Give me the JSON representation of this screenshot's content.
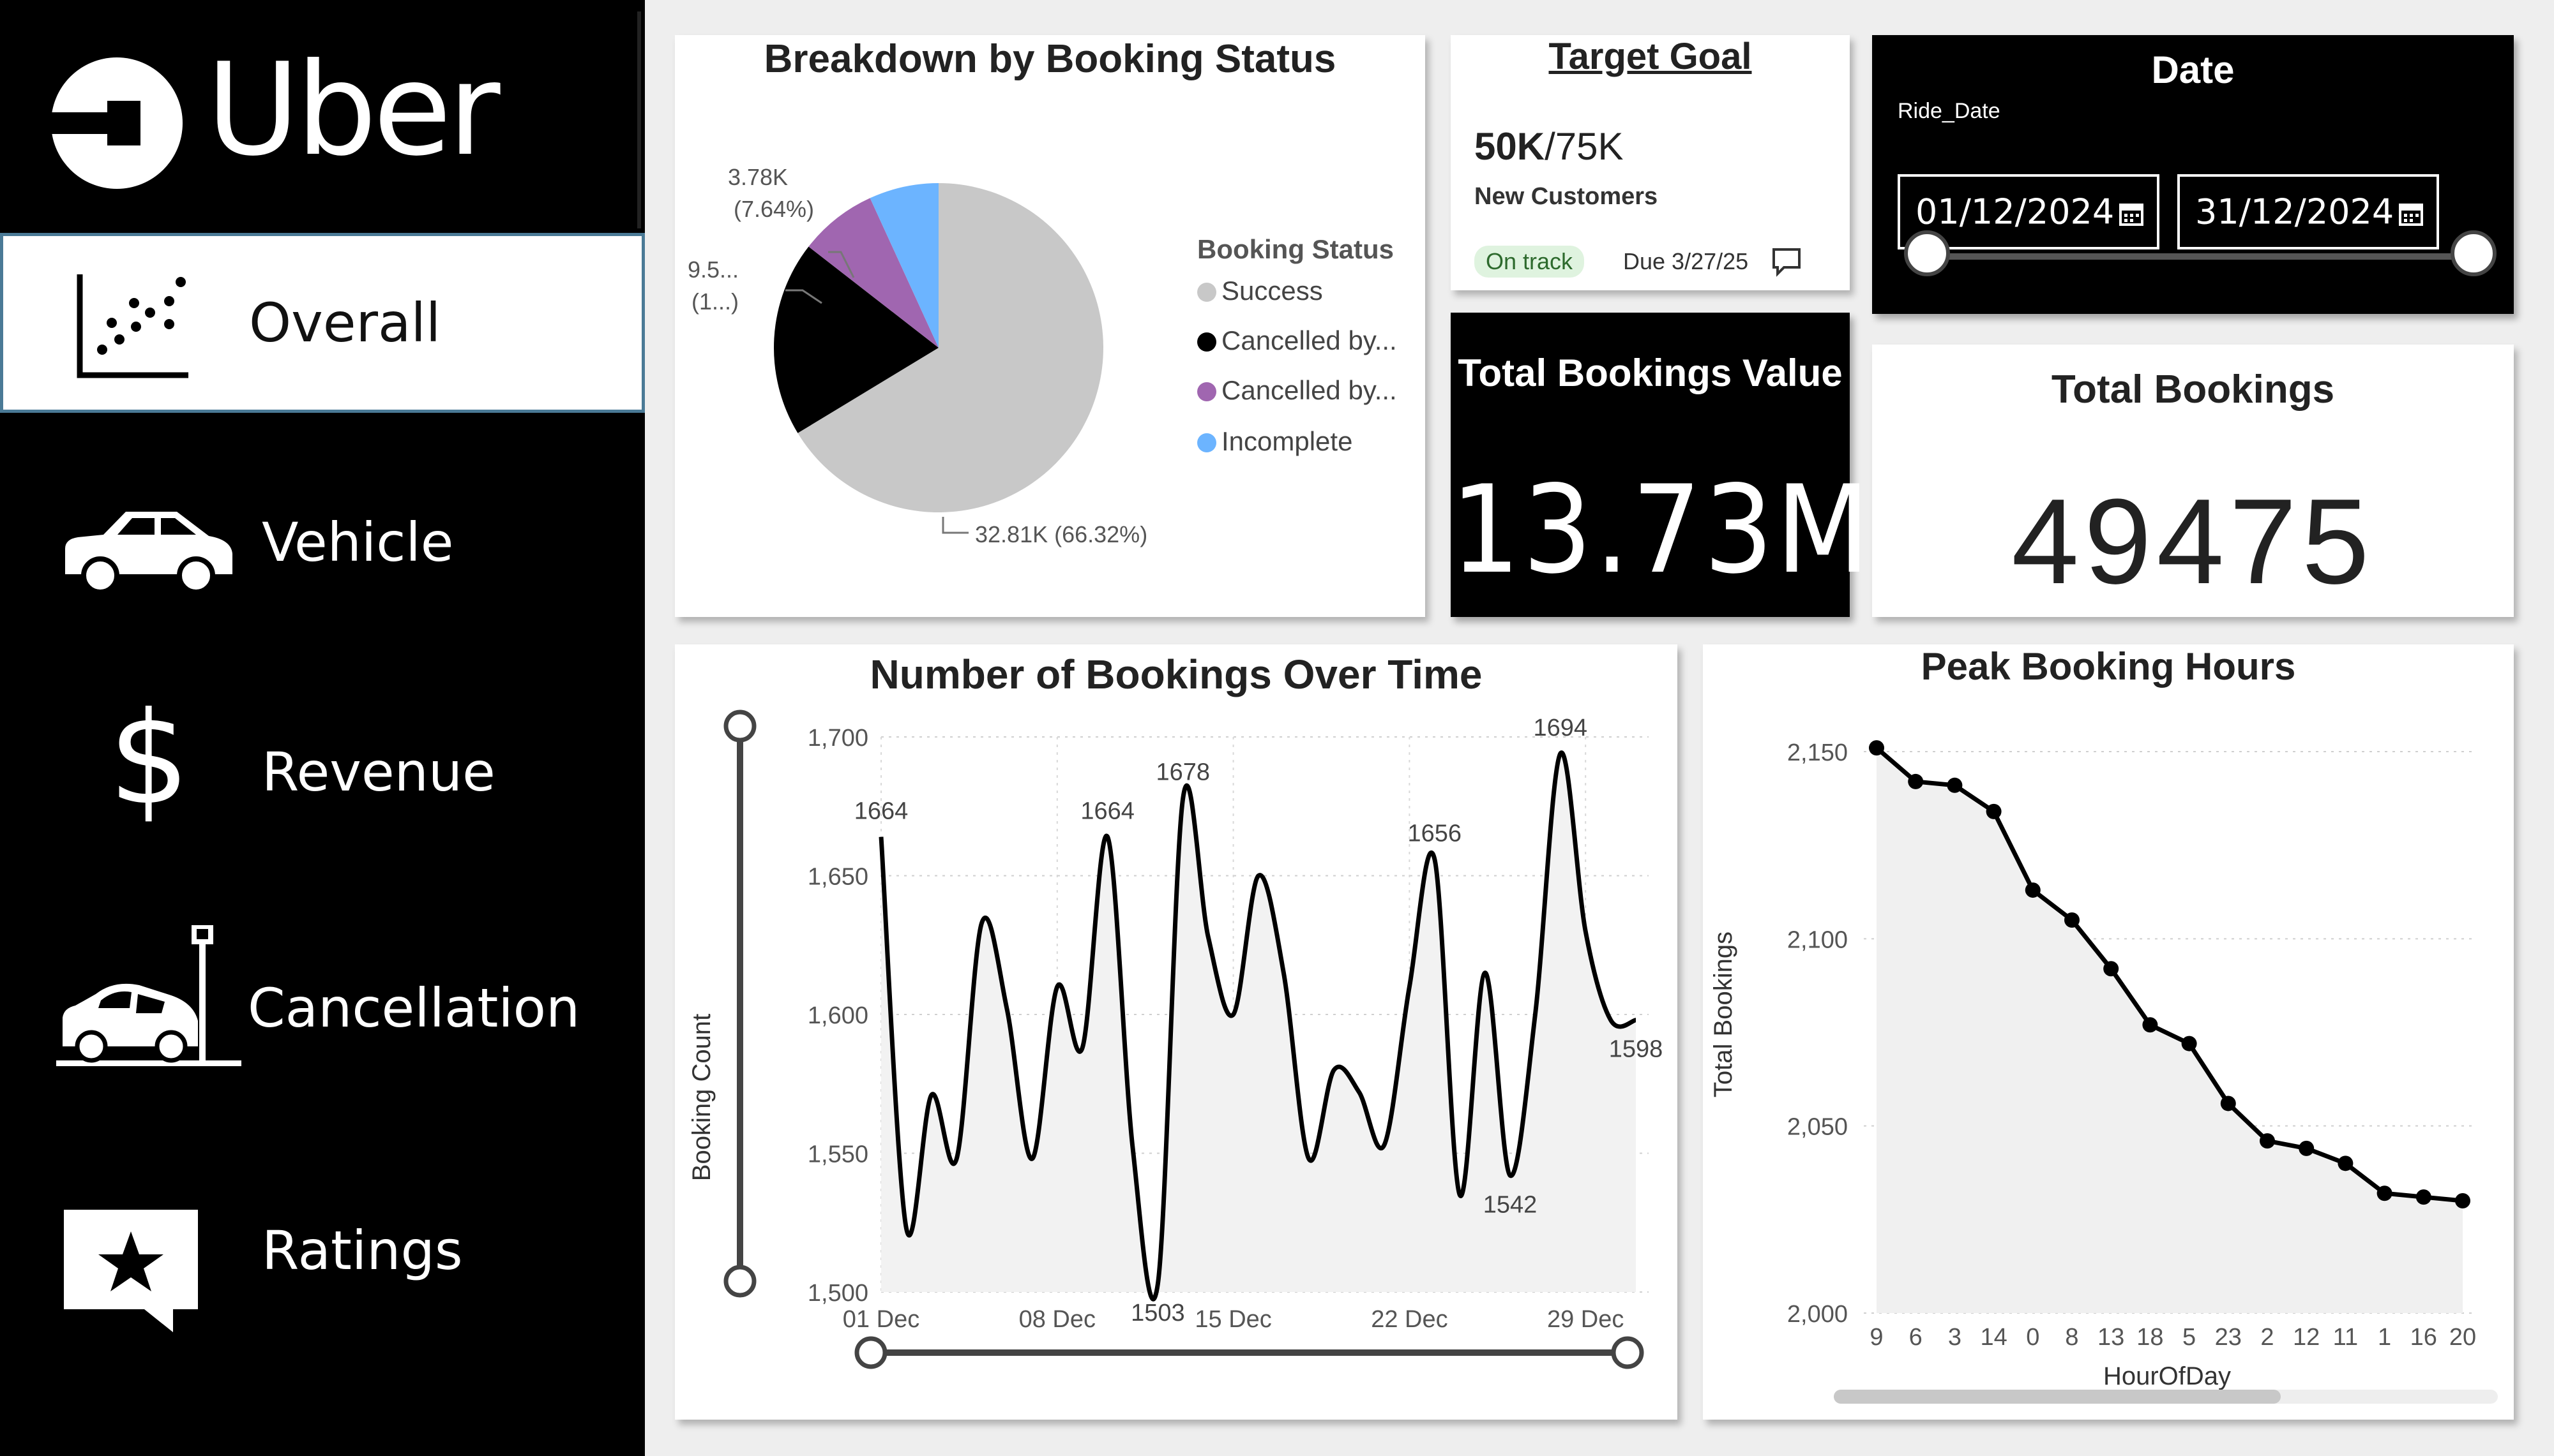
{
  "brand": {
    "name": "Uber"
  },
  "nav": [
    {
      "label": "Overall",
      "icon": "scatter-chart-icon",
      "active": true
    },
    {
      "label": "Vehicle",
      "icon": "car-icon"
    },
    {
      "label": "Revenue",
      "icon": "dollar-icon"
    },
    {
      "label": "Cancellation",
      "icon": "car-crash-icon"
    },
    {
      "label": "Ratings",
      "icon": "star-speech-bubble-icon"
    }
  ],
  "booking_status": {
    "title": "Breakdown by Booking Status",
    "legend_title": "Booking Status",
    "legend": [
      {
        "label": "Success",
        "color": "#c8c8c8"
      },
      {
        "label": "Cancelled by...",
        "color": "#000000"
      },
      {
        "label": "Cancelled by...",
        "color": "#a066b0"
      },
      {
        "label": "Incomplete",
        "color": "#6cb4ff"
      }
    ],
    "labels": {
      "success": "32.81K (66.32%)",
      "cancelled_black_1": "9.5...",
      "cancelled_black_2": "(1...)",
      "cancelled_purple_1": "3.78K",
      "cancelled_purple_2": "(7.64%)"
    }
  },
  "target": {
    "title": "Target Goal",
    "value": "50K",
    "goal": "/75K",
    "subtitle": "New Customers",
    "status": "On track",
    "due": "Due 3/27/25"
  },
  "date_filter": {
    "title": "Date",
    "field": "Ride_Date",
    "start": "01/12/2024",
    "end": "31/12/2024"
  },
  "total_value": {
    "title": "Total Bookings Value",
    "value": "13.73M"
  },
  "total_bookings": {
    "title": "Total Bookings",
    "value": "49475"
  },
  "colors": {
    "accent": "#000000",
    "pie_success": "#c8c8c8",
    "pie_purple": "#a066b0",
    "pie_blue": "#6cb4ff",
    "on_track_bg": "#dff3df"
  },
  "chart_data": [
    {
      "type": "pie",
      "title": "Breakdown by Booking Status",
      "legend_title": "Booking Status",
      "slices": [
        {
          "label": "Success",
          "value": 32.81,
          "percent": 66.32,
          "display": "32.81K (66.32%)"
        },
        {
          "label": "Cancelled by...",
          "value": 9.5,
          "percent": 19.2
        },
        {
          "label": "Cancelled by...",
          "value": 3.78,
          "percent": 7.64,
          "display": "3.78K (7.64%)"
        },
        {
          "label": "Incomplete",
          "value": 3.38,
          "percent": 6.84
        }
      ]
    },
    {
      "type": "line",
      "title": "Number of Bookings Over Time",
      "xlabel": "",
      "ylabel": "Booking Count",
      "ylim": [
        1500,
        1700
      ],
      "yticks": [
        "1,700",
        "1,650",
        "1,600",
        "1,550",
        "1,500"
      ],
      "xticks": [
        "01 Dec",
        "08 Dec",
        "15 Dec",
        "22 Dec",
        "29 Dec"
      ],
      "x": [
        "01 Dec",
        "02 Dec",
        "03 Dec",
        "04 Dec",
        "05 Dec",
        "06 Dec",
        "07 Dec",
        "08 Dec",
        "09 Dec",
        "10 Dec",
        "11 Dec",
        "12 Dec",
        "13 Dec",
        "14 Dec",
        "15 Dec",
        "16 Dec",
        "17 Dec",
        "18 Dec",
        "19 Dec",
        "20 Dec",
        "21 Dec",
        "22 Dec",
        "23 Dec",
        "24 Dec",
        "25 Dec",
        "26 Dec",
        "27 Dec",
        "28 Dec",
        "29 Dec",
        "30 Dec",
        "31 Dec"
      ],
      "values": [
        1664,
        1523,
        1571,
        1548,
        1633,
        1602,
        1548,
        1610,
        1588,
        1664,
        1552,
        1503,
        1678,
        1628,
        1600,
        1650,
        1615,
        1548,
        1580,
        1572,
        1553,
        1610,
        1656,
        1535,
        1615,
        1542,
        1600,
        1694,
        1630,
        1598,
        1598
      ],
      "data_labels": [
        {
          "x": "01 Dec",
          "text": "1664"
        },
        {
          "x": "10 Dec",
          "text": "1664"
        },
        {
          "x": "12 Dec",
          "text": "1503"
        },
        {
          "x": "13 Dec",
          "text": "1678"
        },
        {
          "x": "23 Dec",
          "text": "1656"
        },
        {
          "x": "26 Dec",
          "text": "1542"
        },
        {
          "x": "28 Dec",
          "text": "1694"
        },
        {
          "x": "31 Dec",
          "text": "1598"
        }
      ]
    },
    {
      "type": "area",
      "title": "Peak Booking Hours",
      "xlabel": "HourOfDay",
      "ylabel": "Total Bookings",
      "ylim": [
        2000,
        2150
      ],
      "yticks": [
        "2,150",
        "2,100",
        "2,050",
        "2,000"
      ],
      "categories": [
        "9",
        "6",
        "3",
        "14",
        "0",
        "8",
        "13",
        "18",
        "5",
        "23",
        "2",
        "12",
        "11",
        "1",
        "16",
        "20"
      ],
      "values": [
        2151,
        2142,
        2141,
        2134,
        2113,
        2105,
        2092,
        2077,
        2072,
        2056,
        2046,
        2044,
        2040,
        2032,
        2031,
        2030
      ],
      "grid": true
    }
  ]
}
